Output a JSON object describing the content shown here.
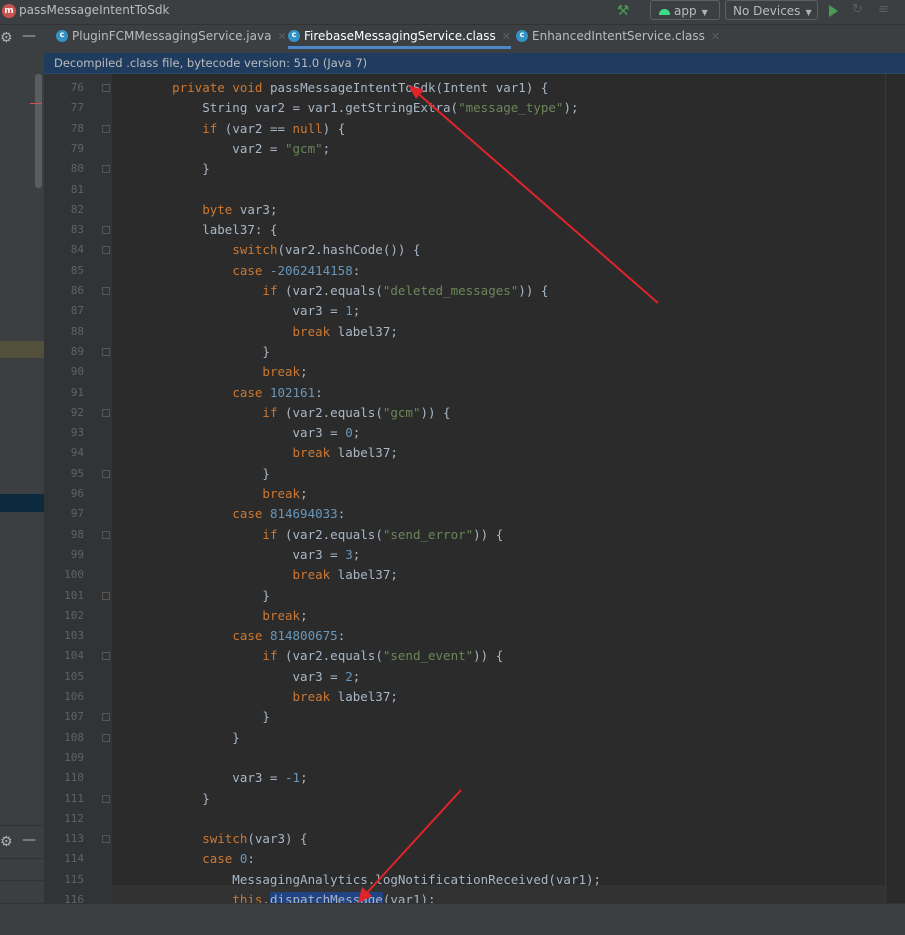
{
  "window": {
    "title": "passMessageIntentToSdk"
  },
  "toolbar": {
    "run_config": "app",
    "devices": "No Devices"
  },
  "tabs": [
    {
      "label": "PluginFCMMessagingService.java",
      "active": false
    },
    {
      "label": "FirebaseMessagingService.class",
      "active": true
    },
    {
      "label": "EnhancedIntentService.class",
      "active": false
    }
  ],
  "banner": {
    "text": "Decompiled .class file, bytecode version: 51.0 (Java 7)"
  },
  "editor": {
    "line_numbers": [
      "76",
      "77",
      "78",
      "79",
      "80",
      "81",
      "82",
      "83",
      "84",
      "85",
      "86",
      "87",
      "88",
      "89",
      "90",
      "91",
      "92",
      "93",
      "94",
      "95",
      "96",
      "97",
      "98",
      "99",
      "100",
      "101",
      "102",
      "103",
      "104",
      "105",
      "106",
      "107",
      "108",
      "109",
      "110",
      "111",
      "112",
      "113",
      "114",
      "115",
      "116"
    ],
    "lines": [
      "    private void passMessageIntentToSdk(Intent var1) {",
      "        String var2 = var1.getStringExtra(\"message_type\");",
      "        if (var2 == null) {",
      "            var2 = \"gcm\";",
      "        }",
      "",
      "        byte var3;",
      "        label37: {",
      "            switch(var2.hashCode()) {",
      "            case -2062414158:",
      "                if (var2.equals(\"deleted_messages\")) {",
      "                    var3 = 1;",
      "                    break label37;",
      "                }",
      "                break;",
      "            case 102161:",
      "                if (var2.equals(\"gcm\")) {",
      "                    var3 = 0;",
      "                    break label37;",
      "                }",
      "                break;",
      "            case 814694033:",
      "                if (var2.equals(\"send_error\")) {",
      "                    var3 = 3;",
      "                    break label37;",
      "                }",
      "                break;",
      "            case 814800675:",
      "                if (var2.equals(\"send_event\")) {",
      "                    var3 = 2;",
      "                    break label37;",
      "                }",
      "            }",
      "",
      "            var3 = -1;",
      "        }",
      "",
      "        switch(var3) {",
      "        case 0:",
      "            MessagingAnalytics.logNotificationReceived(var1);",
      "            this.dispatchMessage(var1);"
    ]
  },
  "colors": {
    "keyword": "#cc7832",
    "string": "#6a8759",
    "number": "#6897bb",
    "text": "#a9b7c6",
    "annotation_arrow": "#e0242a",
    "selection": "#214283"
  }
}
